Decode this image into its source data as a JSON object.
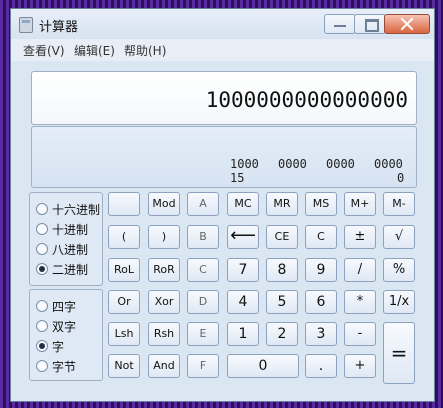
{
  "window": {
    "title": "计算器"
  },
  "menu": {
    "view": "查看(V)",
    "edit": "编辑(E)",
    "help": "帮助(H)"
  },
  "display": {
    "value": "1000000000000000"
  },
  "bit_display": {
    "row1": [
      "1000",
      "0000",
      "0000",
      "0000"
    ],
    "row2": [
      "15",
      "0"
    ]
  },
  "radix_modes": [
    {
      "label": "十六进制",
      "selected": false
    },
    {
      "label": "十进制",
      "selected": false
    },
    {
      "label": "八进制",
      "selected": false
    },
    {
      "label": "二进制",
      "selected": true
    }
  ],
  "word_sizes": [
    {
      "label": "四字",
      "selected": false
    },
    {
      "label": "双字",
      "selected": false
    },
    {
      "label": "字",
      "selected": true
    },
    {
      "label": "字节",
      "selected": false
    }
  ],
  "keys": {
    "mod": "Mod",
    "a": "A",
    "mc": "MC",
    "mr": "MR",
    "ms": "MS",
    "mplus": "M+",
    "mminus": "M-",
    "lparen": "(",
    "rparen": ")",
    "b": "B",
    "backspace": "⟵",
    "ce": "CE",
    "c": "C",
    "plusminus": "±",
    "sqrt": "√",
    "rol": "RoL",
    "ror": "RoR",
    "c_hex": "C",
    "seven": "7",
    "eight": "8",
    "nine": "9",
    "divide": "/",
    "percent": "%",
    "or": "Or",
    "xor": "Xor",
    "d": "D",
    "four": "4",
    "five": "5",
    "six": "6",
    "multiply": "*",
    "reciprocal": "1/x",
    "lsh": "Lsh",
    "rsh": "Rsh",
    "e": "E",
    "one": "1",
    "two": "2",
    "three": "3",
    "minus": "-",
    "equals": "=",
    "not": "Not",
    "and": "And",
    "f": "F",
    "zero": "0",
    "dot": ".",
    "plus": "+"
  }
}
